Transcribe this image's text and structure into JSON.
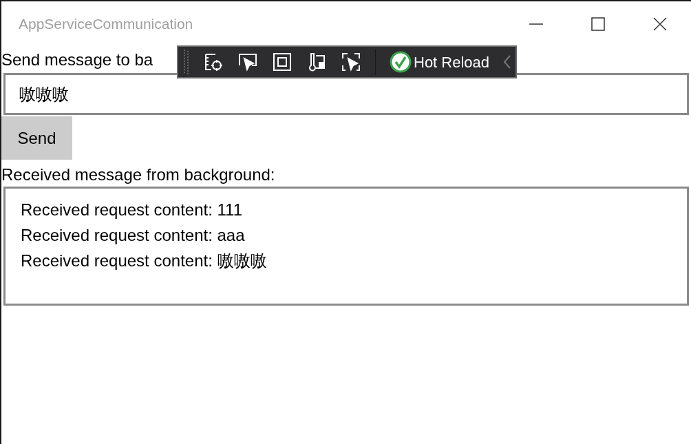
{
  "window": {
    "title": "AppServiceCommunication"
  },
  "send_label": "Send message to ba",
  "message_input": {
    "value": "嗷嗷嗷"
  },
  "send_button": "Send",
  "received_label": "Received message from background:",
  "received_lines": [
    "Received request content: 111",
    "Received request content: aaa",
    "Received request content: 嗷嗷嗷"
  ],
  "debug_toolbar": {
    "hot_reload": {
      "label": "Hot Reload",
      "ok": true
    }
  }
}
